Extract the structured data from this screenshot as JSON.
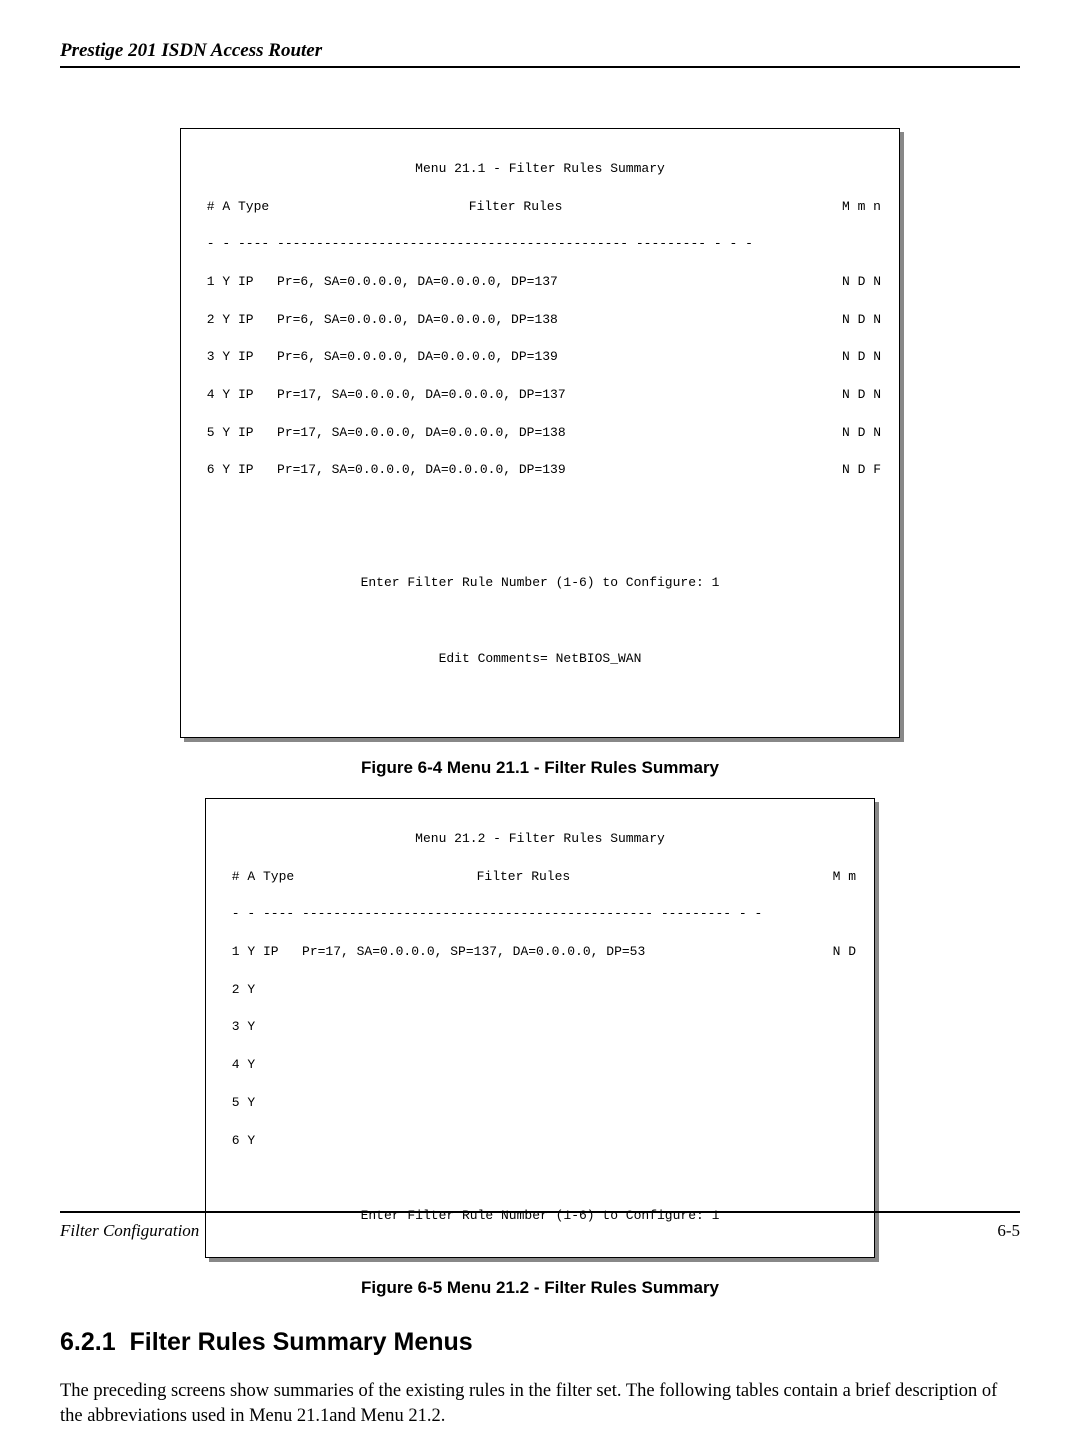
{
  "header": {
    "title": "Prestige 201 ISDN Access Router"
  },
  "terminal1": {
    "title": "Menu 21.1 - Filter Rules Summary",
    "columns_left": " # A Type",
    "columns_mid": "Filter Rules",
    "columns_right": "M m n",
    "divider": " - - ---- --------------------------------------------- --------- - - -",
    "rows": [
      {
        "left": " 1 Y IP   Pr=6, SA=0.0.0.0, DA=0.0.0.0, DP=137",
        "right": "N D N"
      },
      {
        "left": " 2 Y IP   Pr=6, SA=0.0.0.0, DA=0.0.0.0, DP=138",
        "right": "N D N"
      },
      {
        "left": " 3 Y IP   Pr=6, SA=0.0.0.0, DA=0.0.0.0, DP=139",
        "right": "N D N"
      },
      {
        "left": " 4 Y IP   Pr=17, SA=0.0.0.0, DA=0.0.0.0, DP=137",
        "right": "N D N"
      },
      {
        "left": " 5 Y IP   Pr=17, SA=0.0.0.0, DA=0.0.0.0, DP=138",
        "right": "N D N"
      },
      {
        "left": " 6 Y IP   Pr=17, SA=0.0.0.0, DA=0.0.0.0, DP=139",
        "right": "N D F"
      }
    ],
    "prompt1": "Enter Filter Rule Number (1-6) to Configure: 1",
    "prompt2": "Edit Comments= NetBIOS_WAN"
  },
  "figure1_caption": "Figure 6-4 Menu 21.1 - Filter Rules Summary",
  "terminal2": {
    "title": "Menu 21.2 - Filter Rules Summary",
    "columns_left": " # A Type",
    "columns_mid": "Filter Rules",
    "columns_right": "M m",
    "divider": " - - ---- --------------------------------------------- --------- - -",
    "rows": [
      {
        "left": " 1 Y IP   Pr=17, SA=0.0.0.0, SP=137, DA=0.0.0.0, DP=53",
        "right": "N D"
      },
      {
        "left": " 2 Y",
        "right": ""
      },
      {
        "left": " 3 Y",
        "right": ""
      },
      {
        "left": " 4 Y",
        "right": ""
      },
      {
        "left": " 5 Y",
        "right": ""
      },
      {
        "left": " 6 Y",
        "right": ""
      }
    ],
    "prompt1": "Enter Filter Rule Number (1-6) to Configure: 1"
  },
  "figure2_caption": "Figure 6-5 Menu 21.2 - Filter Rules Summary",
  "section": {
    "number": "6.2.1",
    "title": "Filter Rules Summary Menus"
  },
  "body_paragraph": "The preceding screens show summaries of the existing rules in the filter set.  The following tables contain a brief description of the abbreviations used in Menu 21.1and Menu 21.2.",
  "footer": {
    "left": "Filter Configuration",
    "right": "6-5"
  }
}
